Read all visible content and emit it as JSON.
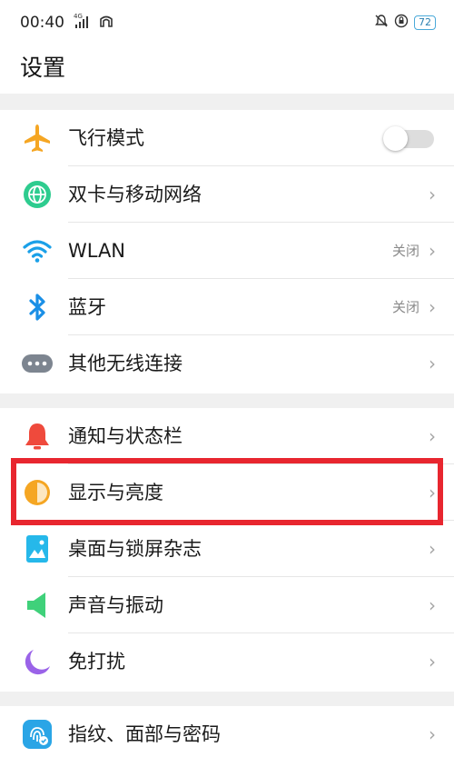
{
  "status_bar": {
    "time": "00:40",
    "network": "4G",
    "battery": "72",
    "icons": [
      "signal-icon",
      "wifi-status-icon",
      "alarm-icon",
      "rotation-lock-icon",
      "battery-icon"
    ]
  },
  "header": {
    "title": "设置"
  },
  "highlight_color": "#e8262f",
  "section1": [
    {
      "label": "飞行模式",
      "icon": "airplane-icon",
      "control": "toggle",
      "toggle_on": false
    },
    {
      "label": "双卡与移动网络",
      "icon": "globe-icon",
      "control": "chevron"
    },
    {
      "label": "WLAN",
      "icon": "wifi-icon",
      "value": "关闭",
      "control": "chevron"
    },
    {
      "label": "蓝牙",
      "icon": "bluetooth-icon",
      "value": "关闭",
      "control": "chevron"
    },
    {
      "label": "其他无线连接",
      "icon": "more-icon",
      "control": "chevron"
    }
  ],
  "section2": [
    {
      "label": "通知与状态栏",
      "icon": "bell-icon",
      "control": "chevron"
    },
    {
      "label": "显示与亮度",
      "icon": "brightness-icon",
      "control": "chevron",
      "highlighted": true
    },
    {
      "label": "桌面与锁屏杂志",
      "icon": "wallpaper-icon",
      "control": "chevron"
    },
    {
      "label": "声音与振动",
      "icon": "speaker-icon",
      "control": "chevron"
    },
    {
      "label": "免打扰",
      "icon": "moon-icon",
      "control": "chevron"
    }
  ],
  "section3": [
    {
      "label": "指纹、面部与密码",
      "icon": "fingerprint-icon",
      "control": "chevron"
    }
  ],
  "chevron_glyph": "›"
}
